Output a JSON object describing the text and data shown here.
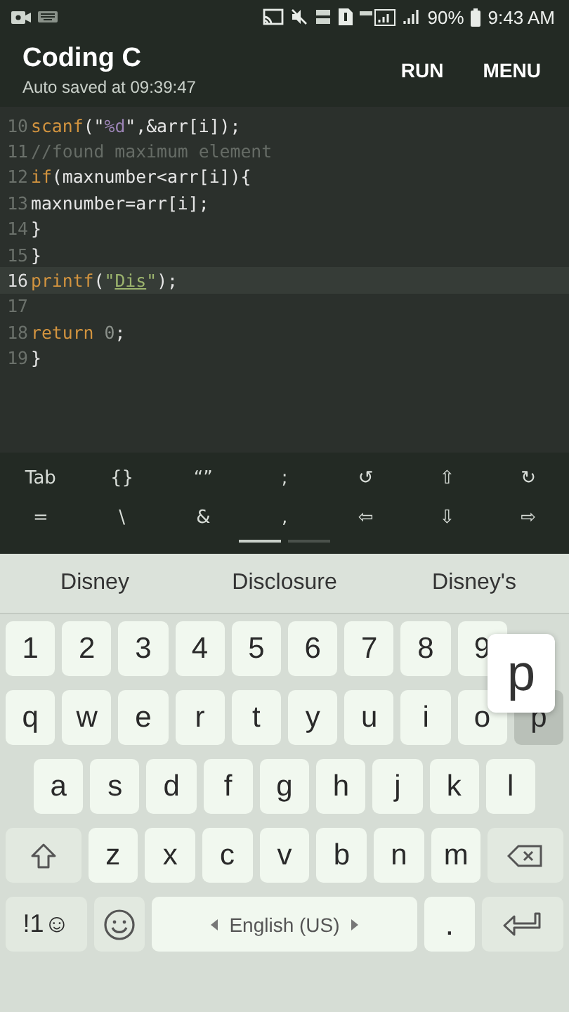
{
  "status_bar": {
    "battery": "90%",
    "time": "9:43 AM"
  },
  "app_bar": {
    "title": "Coding C",
    "subtitle": "Auto saved at 09:39:47",
    "actions": [
      "RUN",
      "MENU"
    ]
  },
  "editor": {
    "lines": [
      {
        "number": "10",
        "current": false,
        "tokens": [
          {
            "text": "scanf",
            "kind": "keyword"
          },
          {
            "text": "(\"",
            "kind": "plain"
          },
          {
            "text": "%d",
            "kind": "format"
          },
          {
            "text": "\",&arr[i]);",
            "kind": "plain"
          }
        ]
      },
      {
        "number": "11",
        "current": false,
        "tokens": [
          {
            "text": "//found maximum element",
            "kind": "comment"
          }
        ]
      },
      {
        "number": "12",
        "current": false,
        "tokens": [
          {
            "text": "if",
            "kind": "keyword"
          },
          {
            "text": "(maxnumber<arr[i]){",
            "kind": "plain"
          }
        ]
      },
      {
        "number": "13",
        "current": false,
        "tokens": [
          {
            "text": "maxnumber=arr[i];",
            "kind": "plain"
          }
        ]
      },
      {
        "number": "14",
        "current": false,
        "tokens": [
          {
            "text": "}",
            "kind": "plain"
          }
        ]
      },
      {
        "number": "15",
        "current": false,
        "tokens": [
          {
            "text": "}",
            "kind": "plain"
          }
        ]
      },
      {
        "number": "16",
        "current": true,
        "tokens": [
          {
            "text": "printf",
            "kind": "keyword"
          },
          {
            "text": "(",
            "kind": "plain"
          },
          {
            "text": "\"",
            "kind": "string"
          },
          {
            "text": "Dis",
            "kind": "composing"
          },
          {
            "text": "\"",
            "kind": "string"
          },
          {
            "text": ");",
            "kind": "plain"
          }
        ]
      },
      {
        "number": "17",
        "current": false
      },
      {
        "number": "18",
        "current": false,
        "tokens": [
          {
            "text": "return ",
            "kind": "keyword"
          },
          {
            "text": "0",
            "kind": "number"
          },
          {
            "text": ";",
            "kind": "plain"
          }
        ]
      },
      {
        "number": "19",
        "current": false,
        "tokens": [
          {
            "text": "}",
            "kind": "plain"
          }
        ]
      }
    ]
  },
  "symbol_bar": {
    "rows": [
      [
        "Tab",
        "{}",
        "“”",
        ";",
        "↺",
        "⇧",
        "↻"
      ],
      [
        "=",
        "\\",
        "&",
        ",",
        "⇦",
        "⇩",
        "⇨"
      ]
    ],
    "pages": [
      {
        "selected": true
      },
      {
        "selected": false
      }
    ]
  },
  "suggestions": [
    "Disney",
    "Disclosure",
    "Disney's"
  ],
  "keyboard": {
    "key_popup": "p",
    "number_row": [
      {
        "label": "1",
        "pressed": false
      },
      {
        "label": "2",
        "pressed": false
      },
      {
        "label": "3",
        "pressed": false
      },
      {
        "label": "4",
        "pressed": false
      },
      {
        "label": "5",
        "pressed": false
      },
      {
        "label": "6",
        "pressed": false
      },
      {
        "label": "7",
        "pressed": false
      },
      {
        "label": "8",
        "pressed": false
      },
      {
        "label": "9",
        "pressed": false
      }
    ],
    "row_1": [
      {
        "label": "q",
        "pressed": false
      },
      {
        "label": "w",
        "pressed": false
      },
      {
        "label": "e",
        "pressed": false
      },
      {
        "label": "r",
        "pressed": false
      },
      {
        "label": "t",
        "pressed": false
      },
      {
        "label": "y",
        "pressed": false
      },
      {
        "label": "u",
        "pressed": false
      },
      {
        "label": "i",
        "pressed": false
      },
      {
        "label": "o",
        "pressed": false
      },
      {
        "label": "p",
        "pressed": true
      }
    ],
    "row_2": [
      {
        "label": "a",
        "pressed": false
      },
      {
        "label": "s",
        "pressed": false
      },
      {
        "label": "d",
        "pressed": false
      },
      {
        "label": "f",
        "pressed": false
      },
      {
        "label": "g",
        "pressed": false
      },
      {
        "label": "h",
        "pressed": false
      },
      {
        "label": "j",
        "pressed": false
      },
      {
        "label": "k",
        "pressed": false
      },
      {
        "label": "l",
        "pressed": false
      }
    ],
    "row_3": [
      {
        "label": "z",
        "pressed": false
      },
      {
        "label": "x",
        "pressed": false
      },
      {
        "label": "c",
        "pressed": false
      },
      {
        "label": "v",
        "pressed": false
      },
      {
        "label": "b",
        "pressed": false
      },
      {
        "label": "n",
        "pressed": false
      },
      {
        "label": "m",
        "pressed": false
      }
    ],
    "symbols_key": "!1☺",
    "space_label": "English (US)",
    "period_key": "."
  }
}
